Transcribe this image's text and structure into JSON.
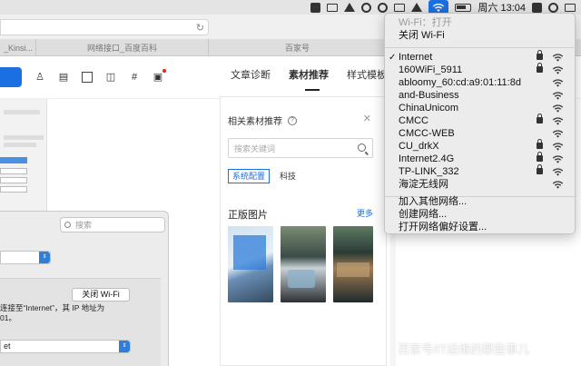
{
  "menubar": {
    "time": "周六 13:04",
    "icons": [
      "app-icon",
      "bookmark-icon",
      "send-icon",
      "wechat-icon",
      "qq-icon",
      "display-icon",
      "volume-icon",
      "wifi-icon",
      "battery-icon",
      "s-app-icon",
      "search-icon",
      "list-icon"
    ]
  },
  "browser": {
    "tabs": [
      {
        "label": "_Kinsi..."
      },
      {
        "label": "网络接口_百度百科"
      },
      {
        "label": "百家号"
      }
    ]
  },
  "editor": {
    "right_tabs": [
      "文章诊断",
      "素材推荐",
      "样式模板"
    ],
    "active_tab": "素材推荐"
  },
  "material_panel": {
    "title": "相关素材推荐",
    "search_placeholder": "搜索关键词",
    "chips": [
      "系统配置",
      "科技"
    ],
    "active_chip": "系统配置",
    "section_title": "正版图片",
    "more_label": "更多"
  },
  "wifi_menu": {
    "status": "Wi-Fi：打开",
    "toggle_label": "关闭 Wi-Fi",
    "networks": [
      {
        "name": "Internet",
        "connected": true,
        "locked": true
      },
      {
        "name": "160WiFi_5911",
        "connected": false,
        "locked": true
      },
      {
        "name": "abloomy_60:cd:a9:01:11:8d",
        "connected": false,
        "locked": false
      },
      {
        "name": "and-Business",
        "connected": false,
        "locked": false
      },
      {
        "name": "ChinaUnicom",
        "connected": false,
        "locked": false
      },
      {
        "name": "CMCC",
        "connected": false,
        "locked": true
      },
      {
        "name": "CMCC-WEB",
        "connected": false,
        "locked": false
      },
      {
        "name": "CU_drkX",
        "connected": false,
        "locked": true
      },
      {
        "name": "Internet2.4G",
        "connected": false,
        "locked": true
      },
      {
        "name": "TP-LINK_332",
        "connected": false,
        "locked": true
      },
      {
        "name": "海淀无线网",
        "connected": false,
        "locked": false
      }
    ],
    "actions": [
      "加入其他网络...",
      "创建网络...",
      "打开网络偏好设置..."
    ]
  },
  "prefs_window": {
    "search_placeholder": "搜索",
    "wifi_off_button": "关闭 Wi-Fi",
    "description": "连接至“Internet”，其 IP 地址为\n01。",
    "network_select": "et"
  },
  "watermark": "百家号/IT运维的那些事儿",
  "colors": {
    "accent": "#1b6fe0",
    "menu_bg": "#ebebeb"
  }
}
